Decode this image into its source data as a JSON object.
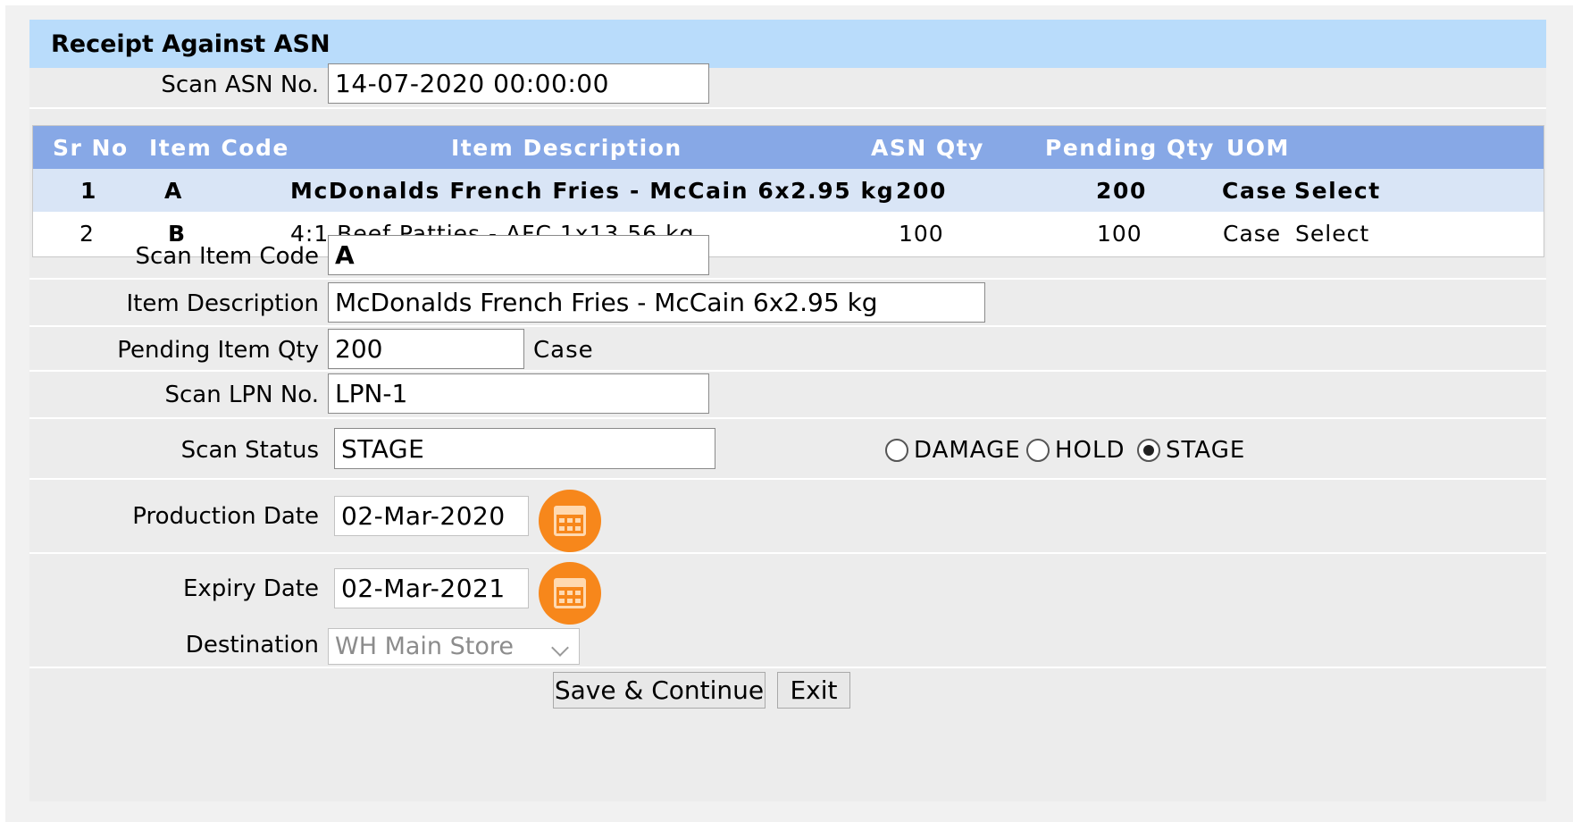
{
  "title": "Receipt Against ASN",
  "asn": {
    "label": "Scan ASN No.",
    "value": "14-07-2020 00:00:00"
  },
  "grid": {
    "headers": [
      "Sr No",
      "Item Code",
      "Item Description",
      "ASN Qty",
      "Pending Qty",
      "UOM"
    ],
    "rows": [
      {
        "sr": "1",
        "code": "A",
        "desc": "McDonalds French Fries - McCain 6x2.95 kg",
        "asn_qty": "200",
        "pending_qty": "200",
        "uom": "Case",
        "action": "Select",
        "selected": true
      },
      {
        "sr": "2",
        "code": "B",
        "desc": "4:1 Beef Patties - AFC 1x13.56 kg",
        "asn_qty": "100",
        "pending_qty": "100",
        "uom": "Case",
        "action": "Select",
        "selected": false
      }
    ]
  },
  "form": {
    "item_code": {
      "label": "Scan Item Code",
      "value": "A"
    },
    "item_desc": {
      "label": "Item Description",
      "value": "McDonalds French Fries - McCain  6x2.95 kg"
    },
    "pending_qty": {
      "label": "Pending Item Qty",
      "value": "200",
      "unit": "Case"
    },
    "lpn": {
      "label": "Scan LPN No.",
      "value": "LPN-1"
    },
    "status": {
      "label": "Scan Status",
      "value": "STAGE",
      "options": [
        {
          "label": "DAMAGE",
          "checked": false
        },
        {
          "label": "HOLD",
          "checked": false
        },
        {
          "label": "STAGE",
          "checked": true
        }
      ]
    },
    "production_date": {
      "label": "Production Date",
      "value": "02-Mar-2020",
      "icon": "calendar-icon"
    },
    "expiry_date": {
      "label": "Expiry Date",
      "value": "02-Mar-2021",
      "icon": "calendar-icon"
    },
    "destination": {
      "label": "Destination",
      "value": "WH Main Store"
    }
  },
  "buttons": {
    "save": "Save & Continue",
    "exit": "Exit"
  },
  "colors": {
    "title_bar": "#b9dcfb",
    "grid_header": "#87a8e6",
    "selected_row": "#d9e5f6",
    "calendar_button": "#f7871b"
  }
}
